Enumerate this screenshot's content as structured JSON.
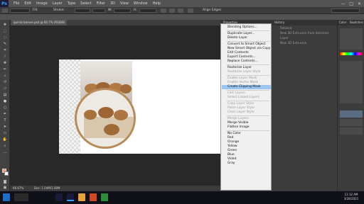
{
  "app": {
    "logo": "Ps"
  },
  "menu": {
    "items": [
      "File",
      "Edit",
      "Image",
      "Layer",
      "Type",
      "Select",
      "Filter",
      "3D",
      "View",
      "Window",
      "Help"
    ],
    "minimize": "—",
    "maximize": "□",
    "close": "✕"
  },
  "options": {
    "shape": "Shape",
    "fill": "Fill:",
    "stroke": "Stroke:",
    "stroke_size": "1 pt",
    "w": "W:",
    "h": "H:",
    "align_edges": "Align Edges",
    "workspace": "Essentials"
  },
  "document": {
    "tab_title": "quinta banner.psd @ 66.7% (RGB/8)"
  },
  "status": {
    "zoom": "66.67%",
    "doc_size": "Doc: 1.04M/1.08M"
  },
  "panels": {
    "properties": "Properties",
    "history": "History",
    "color": "Color",
    "swatches": "Swatches"
  },
  "history": {
    "items": [
      "Rotated",
      "New 3D Extrusion from Selected Layer",
      "New 3D Extrusion"
    ]
  },
  "context_menu": {
    "items": [
      {
        "label": "Blending Options...",
        "state": "enabled"
      },
      {
        "sep": true
      },
      {
        "label": "Duplicate Layer...",
        "state": "enabled"
      },
      {
        "label": "Delete Layer",
        "state": "enabled"
      },
      {
        "sep": true
      },
      {
        "label": "Convert to Smart Object",
        "state": "enabled"
      },
      {
        "label": "New Smart Object via Copy",
        "state": "enabled"
      },
      {
        "label": "Edit Contents",
        "state": "enabled"
      },
      {
        "label": "Export Contents...",
        "state": "enabled"
      },
      {
        "label": "Replace Contents...",
        "state": "enabled"
      },
      {
        "sep": true
      },
      {
        "label": "Rasterize Layer",
        "state": "enabled"
      },
      {
        "label": "Rasterize Layer Style",
        "state": "disabled"
      },
      {
        "sep": true
      },
      {
        "label": "Enable Layer Mask",
        "state": "disabled"
      },
      {
        "label": "Enable Vector Mask",
        "state": "disabled"
      },
      {
        "label": "Create Clipping Mask",
        "state": "highlighted"
      },
      {
        "sep": true
      },
      {
        "label": "Link Layers",
        "state": "disabled"
      },
      {
        "label": "Select Linked Layers",
        "state": "disabled"
      },
      {
        "sep": true
      },
      {
        "label": "Copy Layer Style",
        "state": "disabled"
      },
      {
        "label": "Paste Layer Style",
        "state": "disabled"
      },
      {
        "label": "Clear Layer Style",
        "state": "disabled"
      },
      {
        "sep": true
      },
      {
        "label": "Merge Layers",
        "state": "disabled"
      },
      {
        "label": "Merge Visible",
        "state": "enabled"
      },
      {
        "label": "Flatten Image",
        "state": "enabled"
      },
      {
        "sep": true
      },
      {
        "label": "No Color",
        "state": "enabled"
      },
      {
        "label": "Red",
        "state": "enabled"
      },
      {
        "label": "Orange",
        "state": "enabled"
      },
      {
        "label": "Yellow",
        "state": "enabled"
      },
      {
        "label": "Green",
        "state": "enabled"
      },
      {
        "label": "Blue",
        "state": "enabled"
      },
      {
        "label": "Violet",
        "state": "enabled"
      },
      {
        "label": "Gray",
        "state": "enabled"
      }
    ]
  },
  "taskbar": {
    "time": "11:12 AM",
    "date": "3/28/2021"
  },
  "colors": {
    "highlight": "#99c5f0",
    "foreground_swatch": "#e8a27a",
    "accent": "#31a8ff"
  }
}
